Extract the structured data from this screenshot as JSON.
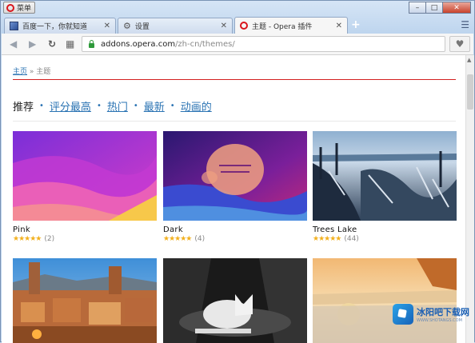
{
  "window": {
    "menu_label": "菜单",
    "controls": [
      "–",
      "□",
      "✕"
    ]
  },
  "tabs": [
    {
      "label": "百度一下，你就知道",
      "icon": "baidu-icon",
      "active": false
    },
    {
      "label": "设置",
      "icon": "gear-icon",
      "active": false
    },
    {
      "label": "主题 - Opera 插件",
      "icon": "opera-icon",
      "active": true
    }
  ],
  "toolbar": {
    "url_domain": "addons.opera.com",
    "url_path": "/zh-cn/themes/"
  },
  "breadcrumb": {
    "home": "主页",
    "separator": "»",
    "current": "主题"
  },
  "filters": {
    "lead": "推荐",
    "items": [
      "评分最高",
      "热门",
      "最新",
      "动画的"
    ]
  },
  "themes": [
    {
      "name": "Pink",
      "stars": "★★★★★",
      "count": "(2)"
    },
    {
      "name": "Dark",
      "stars": "★★★★★",
      "count": "(4)"
    },
    {
      "name": "Trees Lake",
      "stars": "★★★★★",
      "count": "(44)"
    },
    {
      "name": "",
      "stars": "",
      "count": ""
    },
    {
      "name": "",
      "stars": "",
      "count": ""
    },
    {
      "name": "",
      "stars": "",
      "count": ""
    }
  ],
  "watermark": {
    "main": "冰阳吧下载网",
    "sub": "WWW.SHOTANGS.COM"
  },
  "colors": {
    "accent_link": "#2a73b3",
    "divider_red": "#d32020",
    "star": "#f2b01e"
  }
}
